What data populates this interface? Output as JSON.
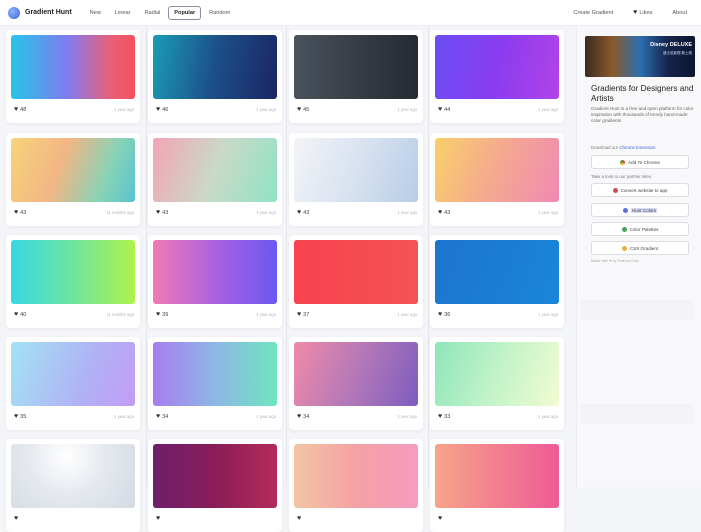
{
  "header": {
    "brand": "Gradient Hunt",
    "nav": [
      "New",
      "Linear",
      "Radial",
      "Popular",
      "Random"
    ],
    "active_nav": "Popular",
    "create_label": "Create Gradient",
    "likes_label": "Likes",
    "about_label": "About"
  },
  "cards": [
    {
      "likes": "48",
      "time": "1 year ago",
      "css": "linear-gradient(90deg,#26c6e8 0%,#7f7bf0 45%,#e8607a 80%,#f3515b 100%)"
    },
    {
      "likes": "46",
      "time": "1 year ago",
      "css": "linear-gradient(100deg,#1b9cb6 0%,#1c4f89 50%,#1b2562 100%)"
    },
    {
      "likes": "45",
      "time": "1 year ago",
      "css": "linear-gradient(90deg,#4a525d 0%,#323942 60%,#262b32 100%)"
    },
    {
      "likes": "44",
      "time": "1 year ago",
      "css": "linear-gradient(100deg,#6b4ef5 0%,#8a3cf0 50%,#b243e8 100%)"
    },
    {
      "likes": "43",
      "time": "11 months ago",
      "css": "linear-gradient(110deg,#f7d37a 0%,#f2b684 40%,#87d3b6 75%,#58c3d1 100%)"
    },
    {
      "likes": "43",
      "time": "1 year ago",
      "css": "linear-gradient(110deg,#f3a4b6 0%,#cad9c8 50%,#8fe3c4 100%)"
    },
    {
      "likes": "43",
      "time": "1 year ago",
      "css": "linear-gradient(110deg,#f3f4f7 0%,#d8e2f0 50%,#b7cde8 100%)"
    },
    {
      "likes": "43",
      "time": "1 year ago",
      "css": "linear-gradient(110deg,#f8d06a 0%,#f5a890 50%,#f08ab4 100%)"
    },
    {
      "likes": "40",
      "time": "11 months ago",
      "css": "linear-gradient(90deg,#37d8e3 0%,#6fe59e 50%,#aef24a 100%)"
    },
    {
      "likes": "39",
      "time": "1 year ago",
      "css": "linear-gradient(90deg,#f07ab6 0%,#a65fe3 55%,#6a59f0 100%)"
    },
    {
      "likes": "37",
      "time": "1 year ago",
      "css": "linear-gradient(90deg,#f8424f 0%,#f45353 100%)"
    },
    {
      "likes": "36",
      "time": "1 year ago",
      "css": "linear-gradient(110deg,#1c74cf 0%,#1a86d8 100%)"
    },
    {
      "likes": "35",
      "time": "1 year ago",
      "css": "linear-gradient(110deg,#a3e3f4 0%,#b0b2f5 60%,#c39cf5 100%)"
    },
    {
      "likes": "34",
      "time": "1 year ago",
      "css": "linear-gradient(90deg,#a77ef0 0%,#8eb6e6 50%,#6ee6c1 100%)"
    },
    {
      "likes": "34",
      "time": "1 year ago",
      "css": "linear-gradient(110deg,#f08aa9 0%,#b478b8 50%,#7d5cbf 100%)"
    },
    {
      "likes": "33",
      "time": "1 year ago",
      "css": "linear-gradient(110deg,#8fe5ba 0%,#c2f3c8 50%,#f2fbd2 100%)"
    },
    {
      "likes": "",
      "time": "",
      "css": "radial-gradient(circle at 45% 20%,#ffffff 0%,#e5e9ef 45%,#d4dae3 100%)"
    },
    {
      "likes": "",
      "time": "",
      "css": "linear-gradient(90deg,#6f1f6b 0%,#8a1d58 50%,#b42b59 100%)"
    },
    {
      "likes": "",
      "time": "",
      "css": "linear-gradient(90deg,#f4c4a4 0%,#f5a1a4 50%,#f79bbd 100%)"
    },
    {
      "likes": "",
      "time": "",
      "css": "linear-gradient(90deg,#f7a48a 0%,#f27f8f 50%,#ef5b95 100%)"
    }
  ],
  "sidebar": {
    "ad_brand": "Disney DELUXE",
    "ad_sub": "迪士尼影视 新上线",
    "title": "Gradients for Designers and Artists",
    "desc": "Gradient Hunt is a free and open platform for color inspiration with thousands of trendy hand-made color gradients",
    "download_label": "Download our",
    "download_link": "Chrome Extension",
    "chrome_btn": "Add To Chrome",
    "partner_label": "Take a look to our partner sites",
    "partners": [
      {
        "label": "Convert website to app",
        "color": "#d04a55"
      },
      {
        "label": "Hunt Colors",
        "color": "#5a6fd8"
      },
      {
        "label": "Color Palettes",
        "color": "#4aa35a"
      },
      {
        "label": "CSS Gradient",
        "color": "#e0b23a"
      }
    ],
    "footer": "Made with ♥ by Francis Ruiz"
  },
  "colors": {
    "accent": "#3b63d9",
    "link": "#3b63d9",
    "highlight": "#d6dcf5"
  }
}
